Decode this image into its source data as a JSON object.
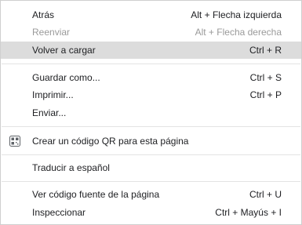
{
  "menu": {
    "items": [
      {
        "label": "Atrás",
        "shortcut": "Alt + Flecha izquierda"
      },
      {
        "label": "Reenviar",
        "shortcut": "Alt + Flecha derecha"
      },
      {
        "label": "Volver a cargar",
        "shortcut": "Ctrl + R"
      },
      {
        "label": "Guardar como...",
        "shortcut": "Ctrl + S"
      },
      {
        "label": "Imprimir...",
        "shortcut": "Ctrl + P"
      },
      {
        "label": "Enviar..."
      },
      {
        "label": "Crear un código QR para esta página",
        "icon": "qr-code-icon"
      },
      {
        "label": "Traducir a español"
      },
      {
        "label": "Ver código fuente de la página",
        "shortcut": "Ctrl + U"
      },
      {
        "label": "Inspeccionar",
        "shortcut": "Ctrl + Mayús + I"
      }
    ]
  },
  "colors": {
    "highlight": "#dcdcdc",
    "text": "#202124",
    "disabled_text": "#9a9a9a",
    "separator": "#e3e3e3"
  }
}
